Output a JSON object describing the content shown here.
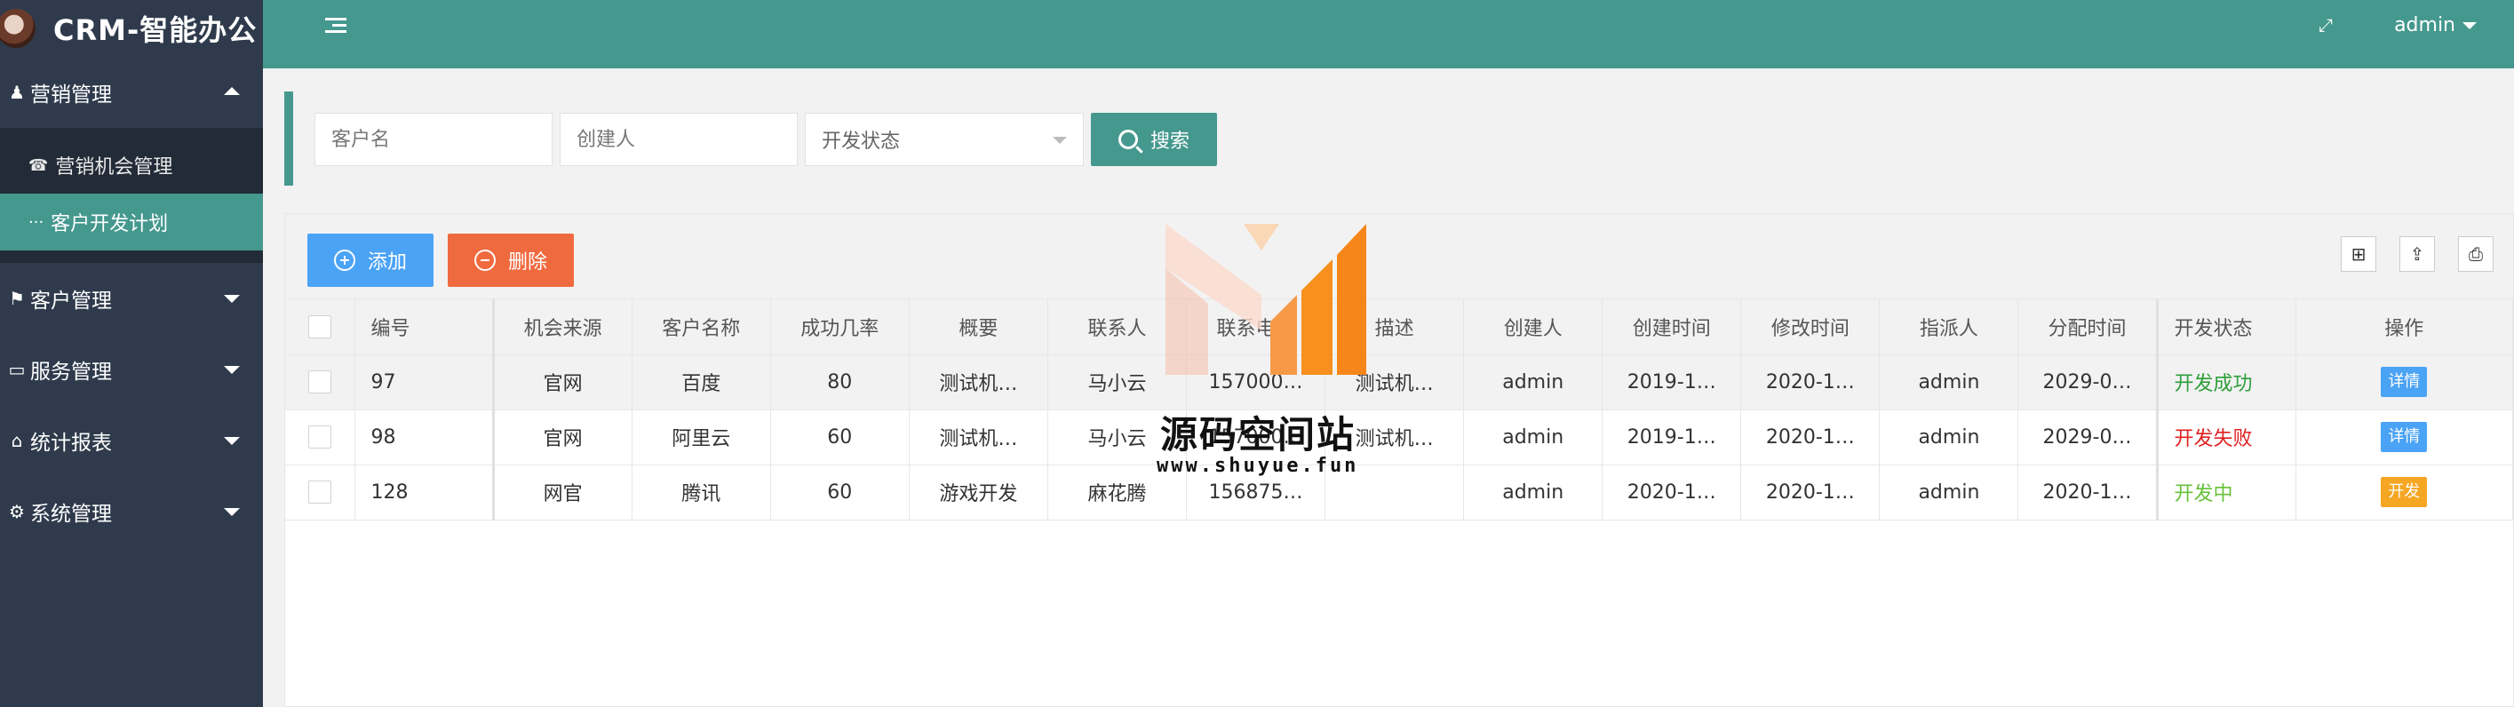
{
  "app": {
    "title": "CRM-智能办公"
  },
  "topbar": {
    "user": "admin"
  },
  "sidebar": {
    "groups": [
      {
        "label": "营销管理",
        "icon": "user-icon",
        "expanded": true,
        "items": [
          {
            "label": "营销机会管理",
            "icon": "phone-icon"
          },
          {
            "label": "客户开发计划",
            "icon": "ellipsis-icon",
            "active": true
          }
        ]
      },
      {
        "label": "客户管理",
        "icon": "flag-icon"
      },
      {
        "label": "服务管理",
        "icon": "monitor-icon"
      },
      {
        "label": "统计报表",
        "icon": "home-icon"
      },
      {
        "label": "系统管理",
        "icon": "gears-icon"
      }
    ]
  },
  "search": {
    "customer_placeholder": "客户名",
    "creator_placeholder": "创建人",
    "status_select": "开发状态",
    "button": "搜索"
  },
  "toolbar": {
    "add": "添加",
    "delete": "删除"
  },
  "table": {
    "headers": [
      "编号",
      "机会来源",
      "客户名称",
      "成功几率",
      "概要",
      "联系人",
      "联系电话",
      "描述",
      "创建人",
      "创建时间",
      "修改时间",
      "指派人",
      "分配时间",
      "开发状态",
      "操作"
    ],
    "rows": [
      {
        "id": "97",
        "source": "官网",
        "customer": "百度",
        "rate": "80",
        "summary": "测试机…",
        "contact": "马小云",
        "phone": "157000…",
        "desc": "测试机…",
        "creator": "admin",
        "created": "2019-1…",
        "modified": "2020-1…",
        "assignee": "admin",
        "assigned": "2029-0…",
        "status": "开发成功",
        "action": "详情"
      },
      {
        "id": "98",
        "source": "官网",
        "customer": "阿里云",
        "rate": "60",
        "summary": "测试机…",
        "contact": "马小云",
        "phone": "157000…",
        "desc": "测试机…",
        "creator": "admin",
        "created": "2019-1…",
        "modified": "2020-1…",
        "assignee": "admin",
        "assigned": "2029-0…",
        "status": "开发失败",
        "action": "详情"
      },
      {
        "id": "128",
        "source": "网官",
        "customer": "腾讯",
        "rate": "60",
        "summary": "游戏开发",
        "contact": "麻花腾",
        "phone": "156875…",
        "desc": "",
        "creator": "admin",
        "created": "2020-1…",
        "modified": "2020-1…",
        "assignee": "admin",
        "assigned": "2020-1…",
        "status": "开发中",
        "action": "开发"
      }
    ]
  },
  "watermark": {
    "text": "源码空间站",
    "url": "www.shuyue.fun"
  }
}
